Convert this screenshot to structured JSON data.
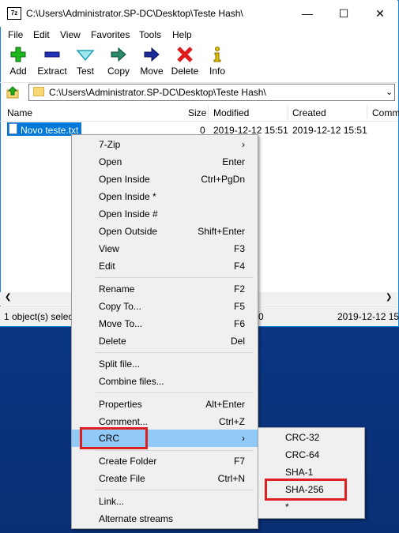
{
  "window": {
    "title": "C:\\Users\\Administrator.SP-DC\\Desktop\\Teste Hash\\",
    "app_icon_text": "7z",
    "minimize": "—",
    "maximize": "☐",
    "close": "✕"
  },
  "menubar": [
    "File",
    "Edit",
    "View",
    "Favorites",
    "Tools",
    "Help"
  ],
  "toolbar": [
    {
      "label": "Add",
      "icon": "plus-icon",
      "color": "#1fb81f"
    },
    {
      "label": "Extract",
      "icon": "minus-icon",
      "color": "#1f2fb8"
    },
    {
      "label": "Test",
      "icon": "check-icon",
      "color": "#20b8c8"
    },
    {
      "label": "Copy",
      "icon": "copy-arrow-icon",
      "color": "#2a8a6a"
    },
    {
      "label": "Move",
      "icon": "move-arrow-icon",
      "color": "#1a2a9a"
    },
    {
      "label": "Delete",
      "icon": "x-icon",
      "color": "#e01b1b"
    },
    {
      "label": "Info",
      "icon": "info-icon",
      "color": "#e0c000"
    }
  ],
  "address": {
    "path": "C:\\Users\\Administrator.SP-DC\\Desktop\\Teste Hash\\"
  },
  "columns": [
    "Name",
    "Size",
    "Modified",
    "Created",
    "Comm"
  ],
  "files": [
    {
      "name": "Novo teste.txt",
      "size": "0",
      "modified": "2019-12-12 15:51",
      "created": "2019-12-12 15:51"
    }
  ],
  "status": {
    "selected": "1 object(s) selec",
    "mid": "0",
    "date": "2019-12-12 15"
  },
  "context_menu": {
    "items": [
      {
        "label": "7-Zip",
        "shortcut": "›"
      },
      {
        "label": "Open",
        "shortcut": "Enter"
      },
      {
        "label": "Open Inside",
        "shortcut": "Ctrl+PgDn"
      },
      {
        "label": "Open Inside *",
        "shortcut": ""
      },
      {
        "label": "Open Inside #",
        "shortcut": ""
      },
      {
        "label": "Open Outside",
        "shortcut": "Shift+Enter"
      },
      {
        "label": "View",
        "shortcut": "F3"
      },
      {
        "label": "Edit",
        "shortcut": "F4"
      },
      {
        "label": "Rename",
        "shortcut": "F2"
      },
      {
        "label": "Copy To...",
        "shortcut": "F5"
      },
      {
        "label": "Move To...",
        "shortcut": "F6"
      },
      {
        "label": "Delete",
        "shortcut": "Del"
      },
      {
        "label": "Split file...",
        "shortcut": ""
      },
      {
        "label": "Combine files...",
        "shortcut": ""
      },
      {
        "label": "Properties",
        "shortcut": "Alt+Enter"
      },
      {
        "label": "Comment...",
        "shortcut": "Ctrl+Z"
      },
      {
        "label": "CRC",
        "shortcut": "›"
      },
      {
        "label": "Create Folder",
        "shortcut": "F7"
      },
      {
        "label": "Create File",
        "shortcut": "Ctrl+N"
      },
      {
        "label": "Link...",
        "shortcut": ""
      },
      {
        "label": "Alternate streams",
        "shortcut": ""
      }
    ]
  },
  "crc_submenu": {
    "items": [
      "CRC-32",
      "CRC-64",
      "SHA-1",
      "SHA-256",
      "*"
    ]
  },
  "colors": {
    "selection": "#0078d7",
    "menu_highlight": "#91c9f7",
    "annotation_red": "#e02020"
  }
}
